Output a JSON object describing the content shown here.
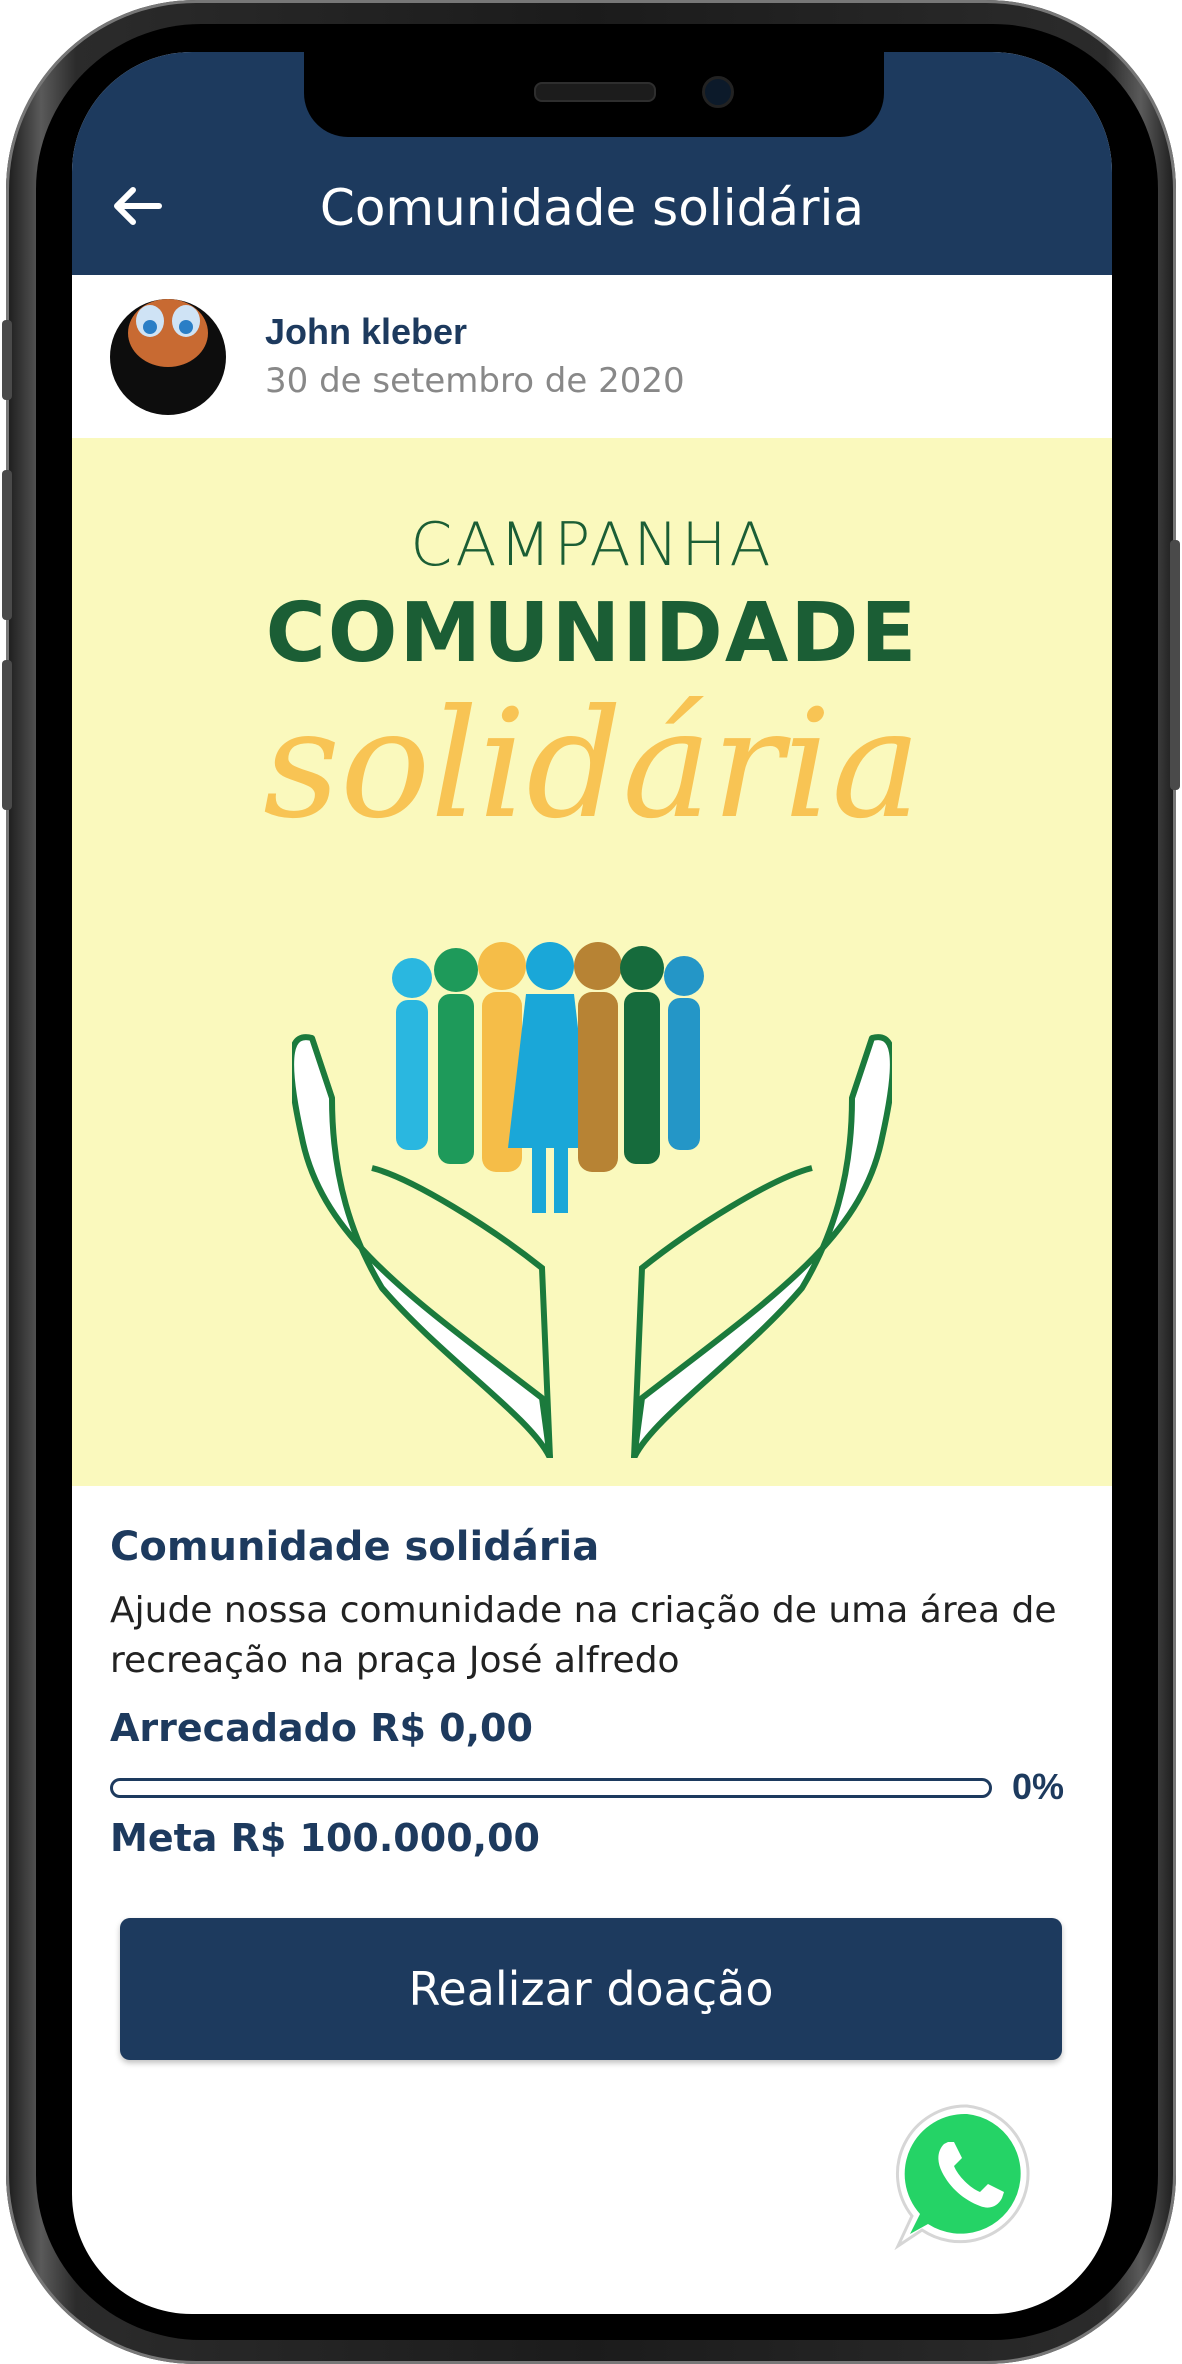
{
  "header": {
    "title": "Comunidade solidária",
    "back_icon": "arrow-left-icon"
  },
  "post": {
    "author_name": "John kleber",
    "date": "30 de setembro de 2020"
  },
  "banner": {
    "line1": "CAMPANHA",
    "line2": "COMUNIDADE",
    "line3": "solidária"
  },
  "campaign": {
    "title": "Comunidade solidária",
    "description": "Ajude nossa comunidade na criação de uma área de recreação na praça José alfredo",
    "raised_label": "Arrecadado R$ 0,00",
    "progress_percent": 0,
    "progress_label": "0%",
    "goal_label": "Meta R$ 100.000,00"
  },
  "actions": {
    "donate_label": "Realizar doação"
  },
  "floating": {
    "whatsapp_icon": "whatsapp-icon"
  },
  "colors": {
    "primary": "#1d3a5e",
    "banner_bg": "#faf9bd",
    "banner_green": "#1b5e35",
    "banner_yellow": "#f8c454",
    "whatsapp_green": "#25d366"
  }
}
